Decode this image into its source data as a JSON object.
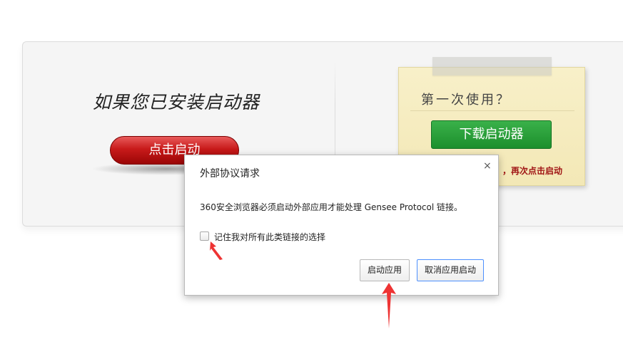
{
  "page": {
    "installed_title": "如果您已安装启动器",
    "start_button_label": "点击启动"
  },
  "note": {
    "title": "第一次使用？",
    "download_button_label": "下载启动器",
    "hint_text": "，再次点击启动"
  },
  "dialog": {
    "title": "外部协议请求",
    "close_glyph": "×",
    "message": "360安全浏览器必须启动外部应用才能处理  Gensee Protocol 链接。",
    "remember_checked": false,
    "remember_label": "记住我对所有此类链接的选择",
    "launch_button_label": "启动应用",
    "cancel_button_label": "取消应用启动"
  },
  "colors": {
    "start_button": "#c81a1a",
    "download_button": "#1c8f2c",
    "hint_text": "#a01515",
    "annotation_arrow": "#ee3333",
    "focused_button_border": "#4d90fe"
  }
}
